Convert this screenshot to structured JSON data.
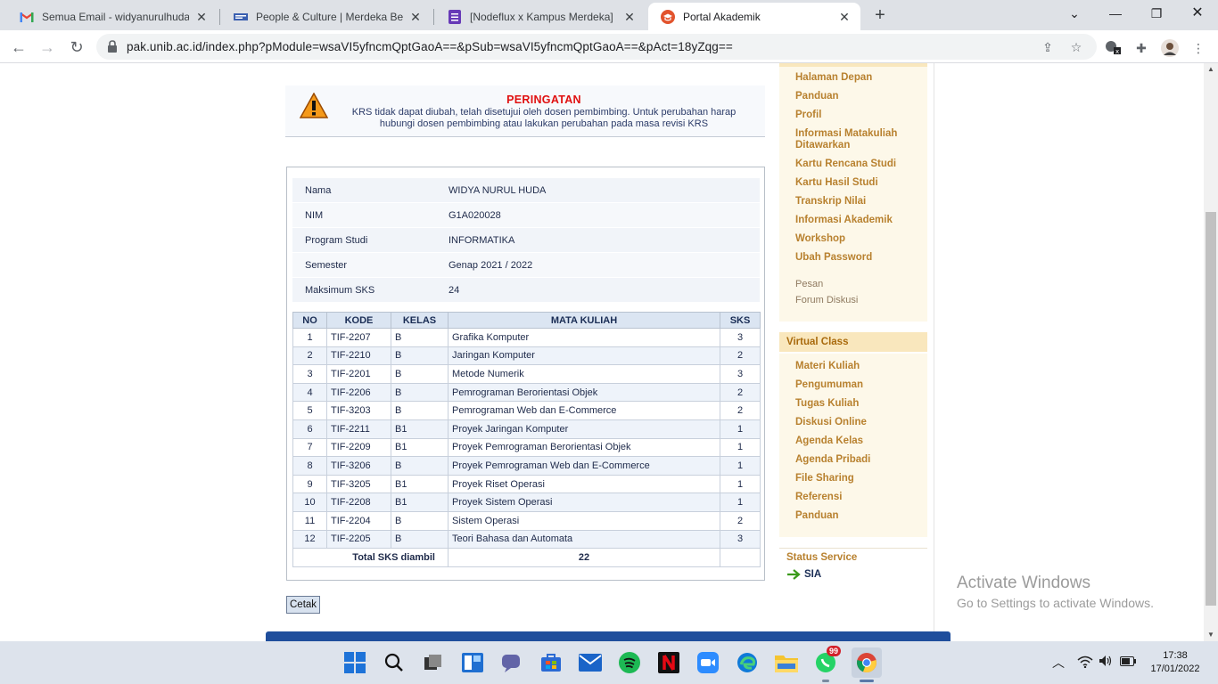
{
  "browser": {
    "tabs": [
      {
        "title": "Semua Email - widyanurulhuda@",
        "icon": "gmail-icon"
      },
      {
        "title": "People & Culture | Merdeka Belaj",
        "icon": "site-icon"
      },
      {
        "title": "[Nodeflux x Kampus Merdeka] Pe",
        "icon": "forms-icon"
      },
      {
        "title": "Portal Akademik",
        "icon": "portal-icon"
      }
    ],
    "url": "pak.unib.ac.id/index.php?pModule=wsaVI5yfncmQptGaoA==&pSub=wsaVI5yfncmQptGaoA==&pAct=18yZqg=="
  },
  "warning": {
    "title": "PERINGATAN",
    "text": "KRS tidak dapat diubah, telah disetujui oleh dosen pembimbing. Untuk perubahan harap hubungi dosen pembimbing atau lakukan perubahan pada masa revisi KRS"
  },
  "student": [
    {
      "label": "Nama",
      "value": "WIDYA NURUL HUDA"
    },
    {
      "label": "NIM",
      "value": "G1A020028"
    },
    {
      "label": "Program Studi",
      "value": "INFORMATIKA"
    },
    {
      "label": "Semester",
      "value": "Genap 2021 / 2022"
    },
    {
      "label": "Maksimum SKS",
      "value": "24"
    }
  ],
  "krs": {
    "headers": [
      "NO",
      "KODE",
      "KELAS",
      "MATA KULIAH",
      "SKS"
    ],
    "rows": [
      {
        "no": "1",
        "kode": "TIF-2207",
        "kelas": "B",
        "mk": "Grafika Komputer",
        "sks": "3"
      },
      {
        "no": "2",
        "kode": "TIF-2210",
        "kelas": "B",
        "mk": "Jaringan Komputer",
        "sks": "2"
      },
      {
        "no": "3",
        "kode": "TIF-2201",
        "kelas": "B",
        "mk": "Metode Numerik",
        "sks": "3"
      },
      {
        "no": "4",
        "kode": "TIF-2206",
        "kelas": "B",
        "mk": "Pemrograman Berorientasi Objek",
        "sks": "2"
      },
      {
        "no": "5",
        "kode": "TIF-3203",
        "kelas": "B",
        "mk": "Pemrograman Web dan E-Commerce",
        "sks": "2"
      },
      {
        "no": "6",
        "kode": "TIF-2211",
        "kelas": "B1",
        "mk": "Proyek Jaringan Komputer",
        "sks": "1"
      },
      {
        "no": "7",
        "kode": "TIF-2209",
        "kelas": "B1",
        "mk": "Proyek Pemrograman Berorientasi Objek",
        "sks": "1"
      },
      {
        "no": "8",
        "kode": "TIF-3206",
        "kelas": "B",
        "mk": "Proyek Pemrograman Web dan E-Commerce",
        "sks": "1"
      },
      {
        "no": "9",
        "kode": "TIF-3205",
        "kelas": "B1",
        "mk": "Proyek Riset Operasi",
        "sks": "1"
      },
      {
        "no": "10",
        "kode": "TIF-2208",
        "kelas": "B1",
        "mk": "Proyek Sistem Operasi",
        "sks": "1"
      },
      {
        "no": "11",
        "kode": "TIF-2204",
        "kelas": "B",
        "mk": "Sistem Operasi",
        "sks": "2"
      },
      {
        "no": "12",
        "kode": "TIF-2205",
        "kelas": "B",
        "mk": "Teori Bahasa dan Automata",
        "sks": "3"
      }
    ],
    "total_label": "Total SKS diambil",
    "total_value": "22"
  },
  "cetak_label": "Cetak",
  "menu": {
    "main": [
      "Halaman Depan",
      "Panduan",
      "Profil",
      "Informasi Matakuliah Ditawarkan",
      "Kartu Rencana Studi",
      "Kartu Hasil Studi",
      "Transkrip Nilai",
      "Informasi Akademik",
      "Workshop",
      "Ubah Password"
    ],
    "plain": [
      "Pesan",
      "Forum Diskusi"
    ],
    "virtual_title": "Virtual Class",
    "virtual": [
      "Materi Kuliah",
      "Pengumuman",
      "Tugas Kuliah",
      "Diskusi Online",
      "Agenda Kelas",
      "Agenda Pribadi",
      "File Sharing",
      "Referensi",
      "Panduan"
    ],
    "status_title": "Status Service",
    "status_item": "SIA"
  },
  "activate": {
    "line1": "Activate Windows",
    "line2": "Go to Settings to activate Windows."
  },
  "taskbar": {
    "whatsapp_badge": "99",
    "time": "17:38",
    "date": "17/01/2022"
  },
  "colors": {
    "warning_red": "#e01010",
    "menu_gold": "#b8812f",
    "footer_blue": "#1f4e9c"
  }
}
